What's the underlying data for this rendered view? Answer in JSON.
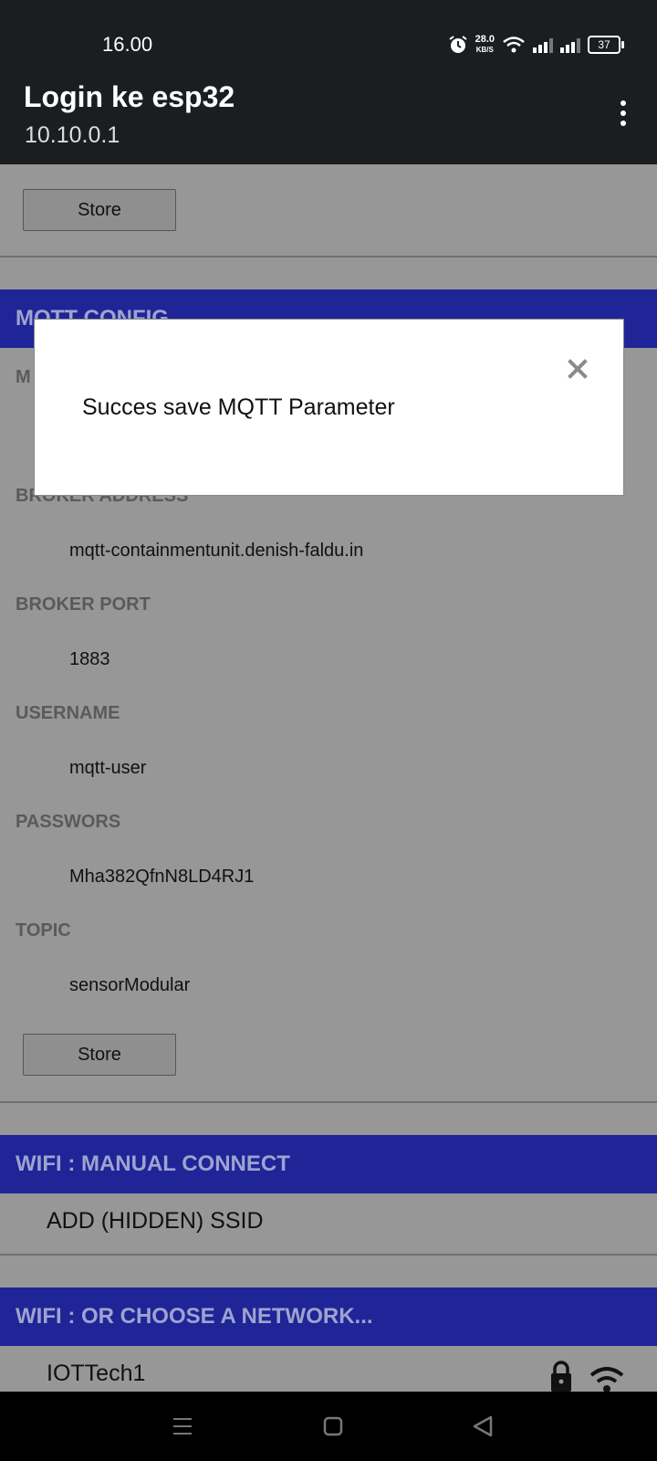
{
  "status": {
    "time": "16.00",
    "speed_value": "28.0",
    "speed_unit": "KB/S",
    "battery": "37"
  },
  "app": {
    "title": "Login ke esp32",
    "subtitle": "10.10.0.1"
  },
  "top": {
    "store_label": "Store"
  },
  "mqtt": {
    "header": "MQTT CONFIG",
    "first_label_partial": "M",
    "fields": [
      {
        "label": "BROKER ADDRESS",
        "value": "mqtt-containmentunit.denish-faldu.in"
      },
      {
        "label": "BROKER PORT",
        "value": "1883"
      },
      {
        "label": "USERNAME",
        "value": "mqtt-user"
      },
      {
        "label": "PASSWORS",
        "value": "Mha382QfnN8LD4RJ1"
      },
      {
        "label": "TOPIC",
        "value": "sensorModular"
      }
    ],
    "store_label": "Store"
  },
  "wifi_manual": {
    "header": "WIFI : MANUAL CONNECT",
    "item": "ADD (HIDDEN) SSID"
  },
  "wifi_choose": {
    "header": "WIFI : OR CHOOSE A NETWORK...",
    "networks": [
      {
        "ssid": "IOTTech1"
      }
    ]
  },
  "modal": {
    "message": "Succes save MQTT Parameter"
  },
  "colors": {
    "header_bg": "#1f2597",
    "overlay_bg": "#979797",
    "appbar_bg": "#1b1e20"
  }
}
